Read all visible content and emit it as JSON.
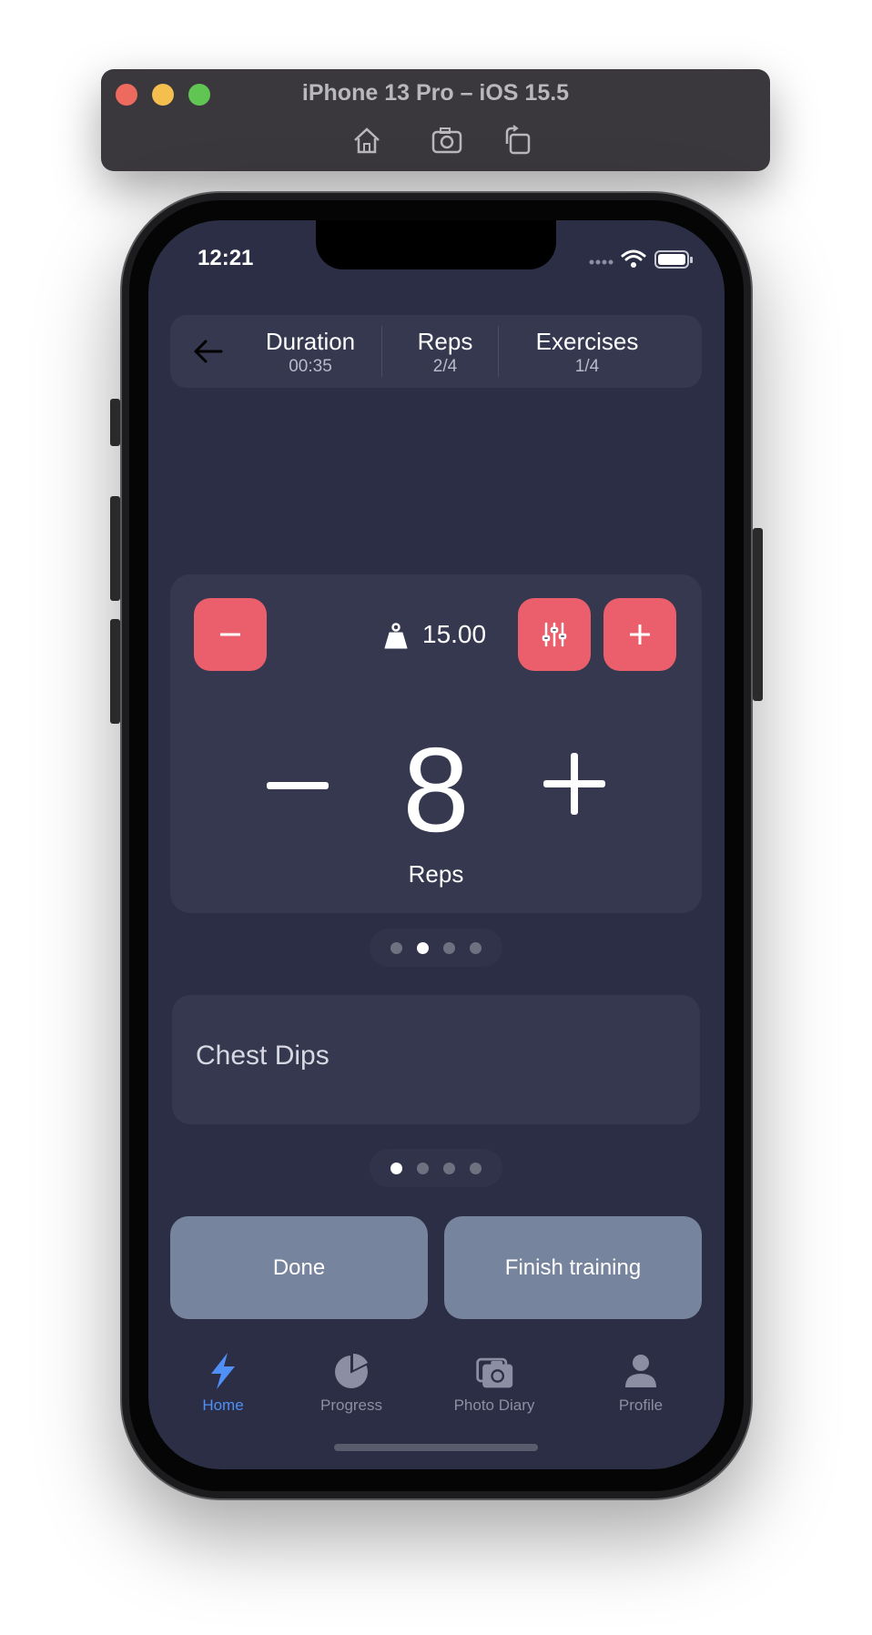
{
  "simulator": {
    "title": "iPhone 13 Pro – iOS 15.5",
    "toolbar": [
      "home-icon",
      "screenshot-icon",
      "rotate-icon"
    ]
  },
  "status_bar": {
    "time": "12:21"
  },
  "header": {
    "back_icon": "arrow-left-icon",
    "stats": [
      {
        "title": "Duration",
        "value": "00:35"
      },
      {
        "title": "Reps",
        "value": "2/4"
      },
      {
        "title": "Exercises",
        "value": "1/4"
      }
    ]
  },
  "workout": {
    "weight": "15.00",
    "reps": "8",
    "reps_label": "Reps",
    "colors": {
      "accent": "#ea5f6b",
      "card": "#363850",
      "background": "#2b2e45"
    }
  },
  "set_pager": {
    "count": 4,
    "active_index": 1
  },
  "exercise": {
    "name": "Chest Dips"
  },
  "exercise_pager": {
    "count": 4,
    "active_index": 0
  },
  "actions": {
    "done": "Done",
    "finish": "Finish training"
  },
  "tabs": [
    {
      "label": "Home",
      "icon": "lightning-icon",
      "active": true
    },
    {
      "label": "Progress",
      "icon": "pie-chart-icon",
      "active": false
    },
    {
      "label": "Photo Diary",
      "icon": "camera-icon",
      "active": false
    },
    {
      "label": "Profile",
      "icon": "person-icon",
      "active": false
    }
  ],
  "tab_active_color": "#4f8ff7"
}
